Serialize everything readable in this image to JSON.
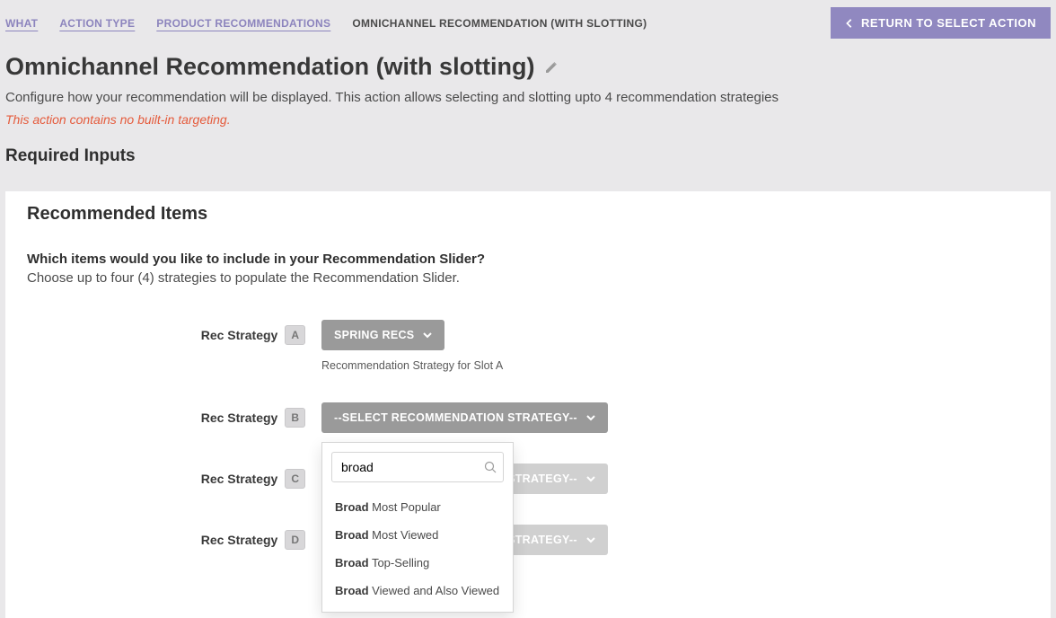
{
  "breadcrumbs": {
    "what": "WHAT",
    "action_type": "ACTION TYPE",
    "product_recs": "PRODUCT RECOMMENDATIONS",
    "current": "OMNICHANNEL RECOMMENDATION (WITH SLOTTING)"
  },
  "return_label": "RETURN TO SELECT ACTION",
  "page": {
    "title": "Omnichannel Recommendation (with slotting)",
    "description": "Configure how your recommendation will be displayed. This action allows selecting and slotting upto 4 recommendation strategies",
    "warning": "This action contains no built-in targeting.",
    "required_heading": "Required Inputs"
  },
  "panel": {
    "title": "Recommended Items",
    "q1": "Which items would you like to include in your Recommendation Slider?",
    "q2": "Choose up to four (4) strategies to populate the Recommendation Slider."
  },
  "slots": {
    "label": "Rec Strategy",
    "a": {
      "badge": "A",
      "selected": "SPRING RECS",
      "hint": "Recommendation Strategy for Slot A"
    },
    "b": {
      "badge": "B",
      "selected": "--SELECT RECOMMENDATION STRATEGY--"
    },
    "c": {
      "badge": "C",
      "selected": "--SELECT RECOMMENDATION STRATEGY--"
    },
    "d": {
      "badge": "D",
      "selected": "--SELECT RECOMMENDATION STRATEGY--"
    }
  },
  "dropdown": {
    "search_value": "broad",
    "options": [
      {
        "bold": "Broad",
        "rest": " Most Popular"
      },
      {
        "bold": "Broad",
        "rest": " Most Viewed"
      },
      {
        "bold": "Broad",
        "rest": " Top-Selling"
      },
      {
        "bold": "Broad",
        "rest": " Viewed and Also Viewed"
      }
    ]
  }
}
